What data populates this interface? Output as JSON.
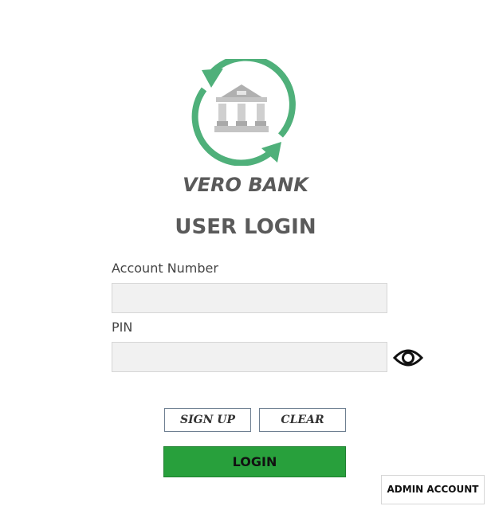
{
  "brand": {
    "name": "VERO BANK",
    "logo_icon": "bank-sync-icon",
    "accent_color": "#4fb07a"
  },
  "form": {
    "title": "USER LOGIN",
    "account_number": {
      "label": "Account Number",
      "value": "",
      "placeholder": ""
    },
    "pin": {
      "label": "PIN",
      "value": "",
      "placeholder": "",
      "toggle_icon": "eye-icon"
    }
  },
  "actions": {
    "signup_label": "SIGN UP",
    "clear_label": "CLEAR",
    "login_label": "LOGIN",
    "login_color": "#28a03c",
    "admin_label": "ADMIN ACCOUNT"
  }
}
